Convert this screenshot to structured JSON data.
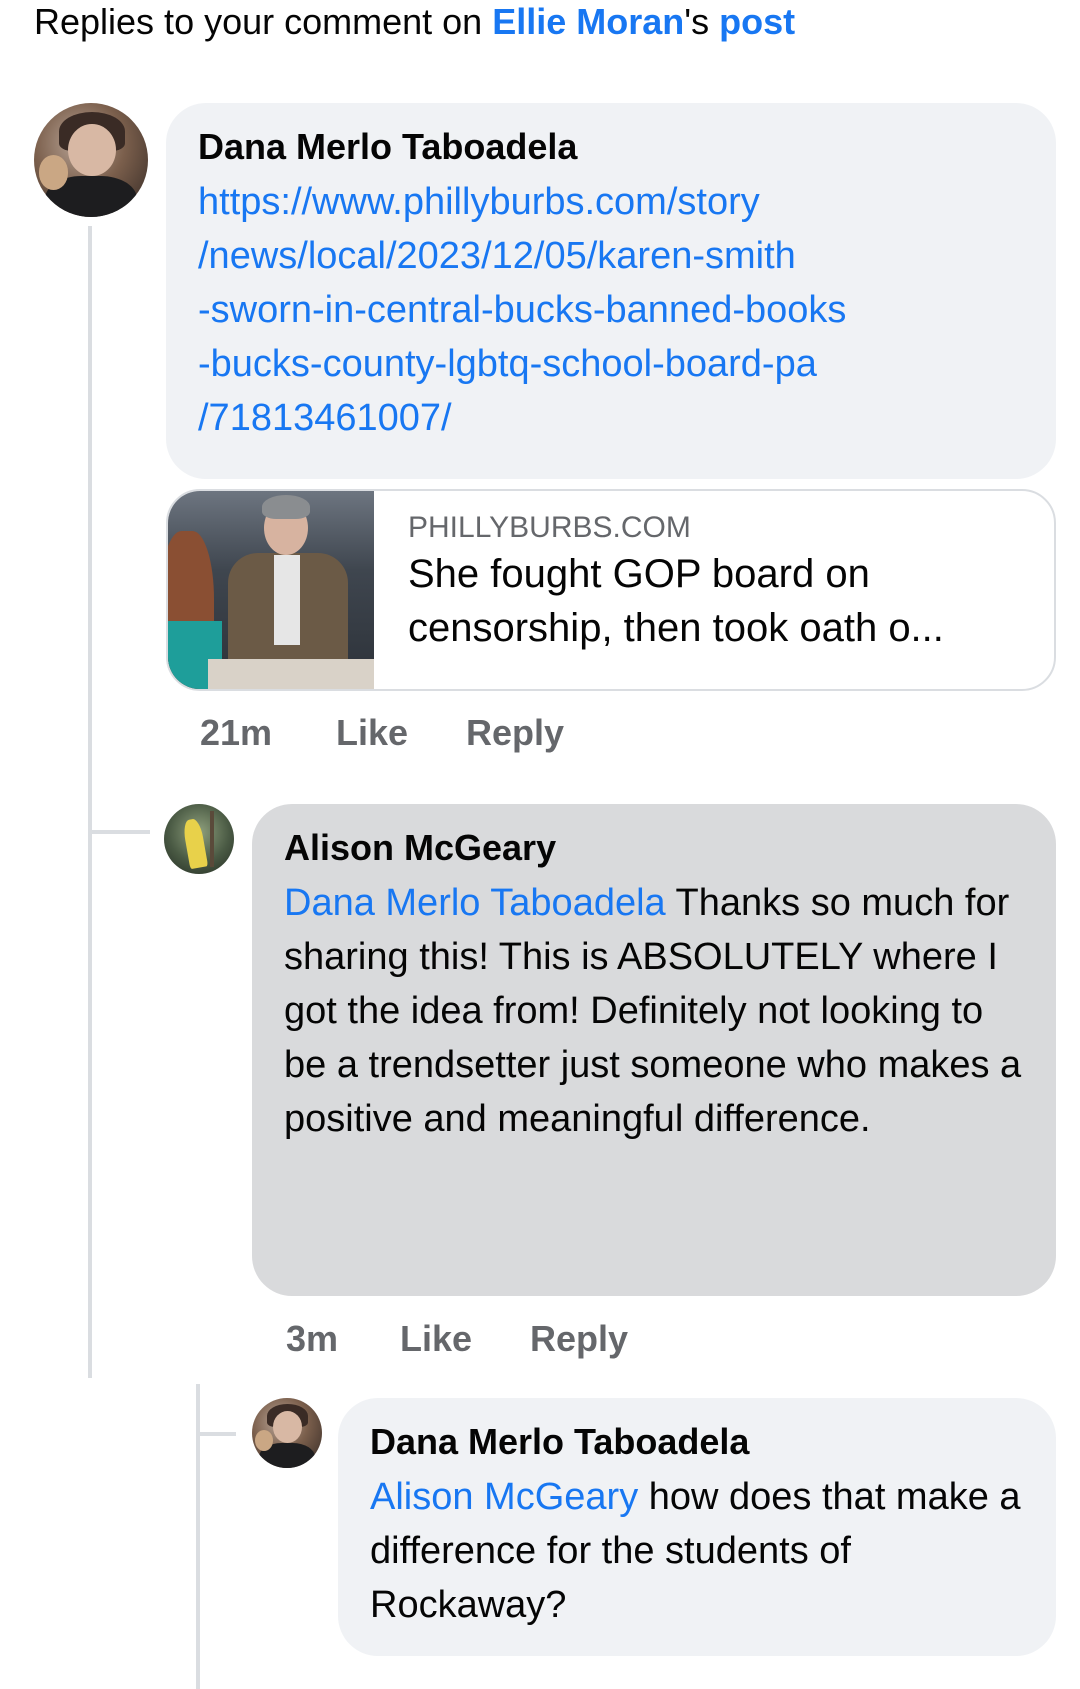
{
  "header": {
    "prefix": "Replies to your comment on ",
    "author": "Ellie Moran",
    "suffix": "'s ",
    "post_link": "post"
  },
  "comments": [
    {
      "author": "Dana Merlo Taboadela",
      "url_lines": [
        "https://www.phillyburbs.com/story",
        "/news/local/2023/12/05/karen-smith",
        "-sworn-in-central-bucks-banned-books",
        "-bucks-county-lgbtq-school-board-pa",
        "/71813461007/"
      ],
      "link_preview": {
        "domain": "PHILLYBURBS.COM",
        "headline": "She fought GOP board on censorship, then took oath o..."
      },
      "time": "21m",
      "like_label": "Like",
      "reply_label": "Reply"
    },
    {
      "author": "Alison McGeary",
      "mention": "Dana Merlo Taboadela",
      "text": " Thanks so much for sharing this!  This is ABSOLUTELY where I got the idea from! Definitely not looking to be a trendsetter just someone who makes a positive and meaningful difference.",
      "time": "3m",
      "like_label": "Like",
      "reply_label": "Reply"
    },
    {
      "author": "Dana Merlo Taboadela",
      "mention": "Alison McGeary",
      "text": " how does that make a difference for the students of Rockaway?"
    }
  ],
  "colors": {
    "link": "#1877f2",
    "bubble_light": "#f0f2f5",
    "bubble_highlight": "#d9dadc",
    "meta_text": "#65676b"
  },
  "icons": {
    "avatar_dana": "avatar-photo",
    "avatar_alison": "avatar-photo",
    "link_thumbnail": "news-photo"
  }
}
